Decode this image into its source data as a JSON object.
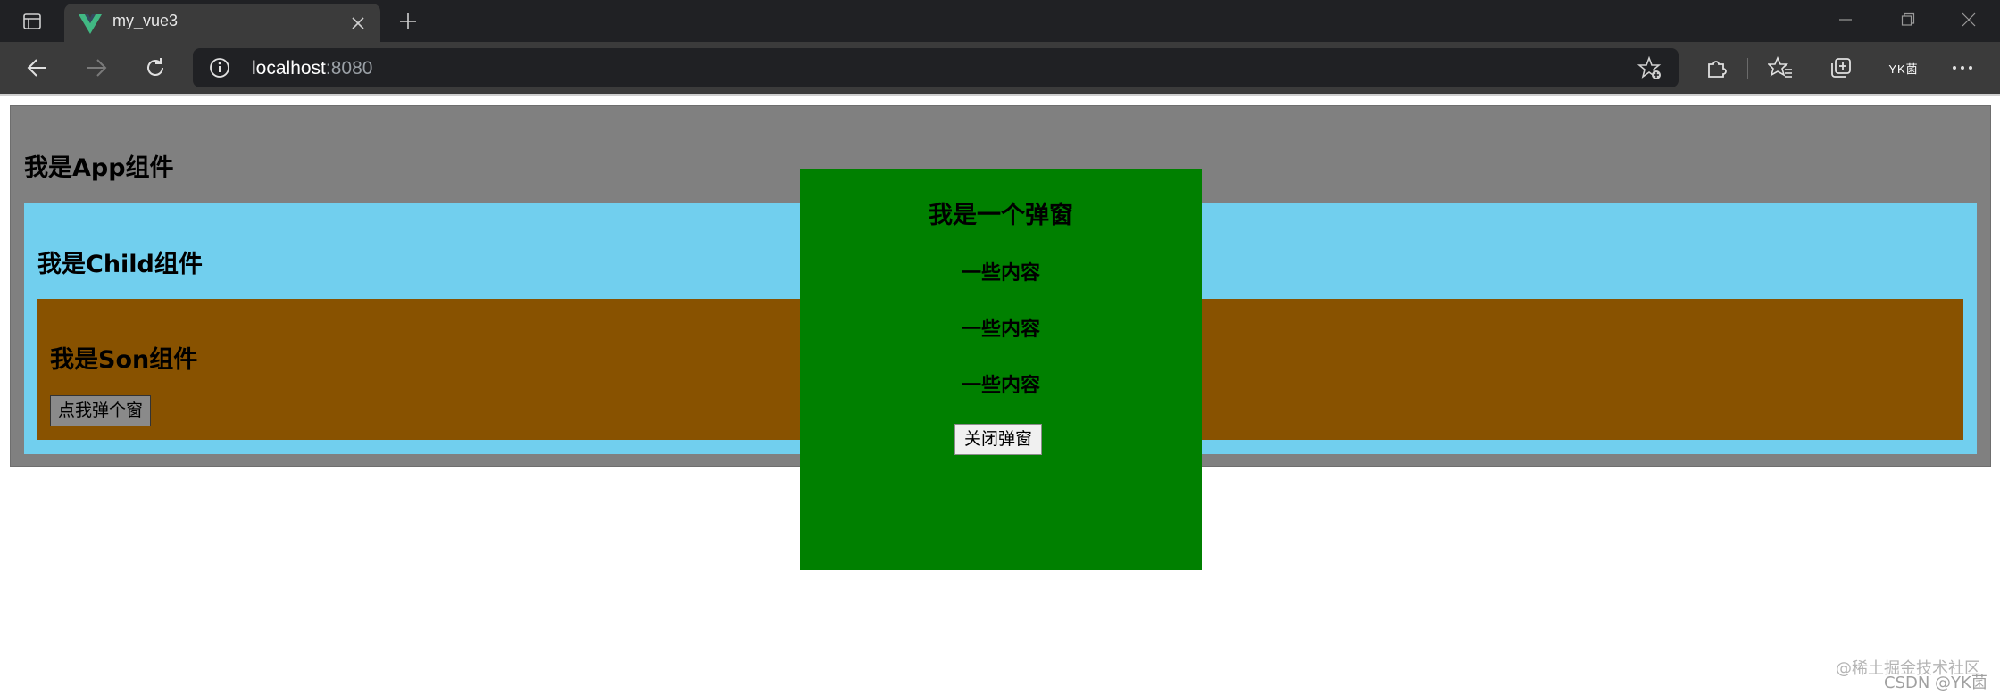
{
  "browser": {
    "tab": {
      "title": "my_vue3"
    },
    "address": {
      "host": "localhost",
      "port": ":8080"
    },
    "profile_label": "YK菌",
    "accent": "#41b883"
  },
  "page": {
    "app_title": "我是App组件",
    "child_title": "我是Child组件",
    "son_title": "我是Son组件",
    "open_button_label": "点我弹个窗",
    "dialog": {
      "title": "我是一个弹窗",
      "lines": [
        "一些内容",
        "一些内容",
        "一些内容"
      ],
      "close_label": "关闭弹窗"
    },
    "colors": {
      "app_bg": "#808080",
      "child_bg": "#71cfee",
      "son_bg": "#885200",
      "dialog_bg": "#008000"
    }
  },
  "watermark": {
    "line1": "@稀土掘金技术社区",
    "line2": "CSDN @YK菌"
  }
}
